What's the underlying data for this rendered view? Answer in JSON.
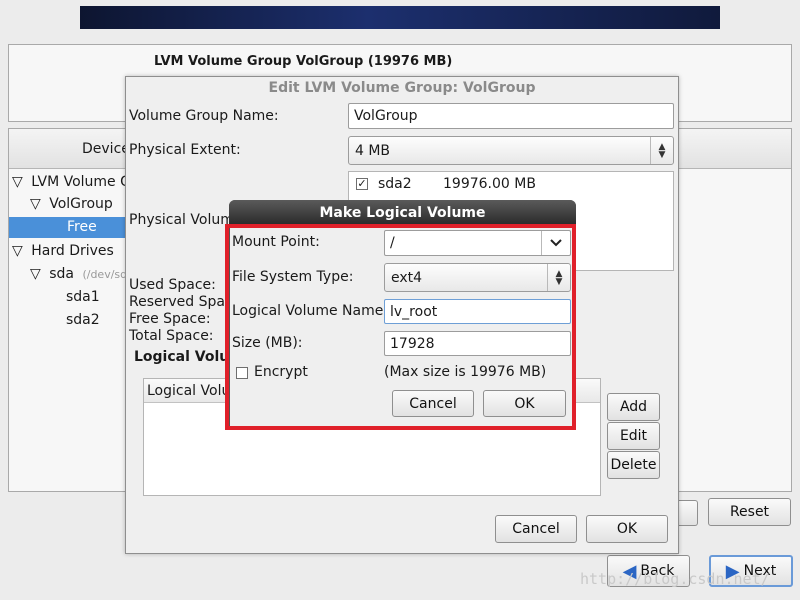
{
  "outer": {
    "group_header": "LVM Volume Group VolGroup (19976 MB)",
    "device_col_label": "Device",
    "tree": [
      {
        "label": "LVM Volume G"
      },
      {
        "label": "VolGroup"
      },
      {
        "label": "Free"
      },
      {
        "label": "Hard Drives"
      },
      {
        "label": "sda",
        "sub": "(/dev/sda"
      },
      {
        "label": "sda1"
      },
      {
        "label": "sda2"
      }
    ],
    "reset_label": "Reset",
    "back_label": "Back",
    "next_label": "Next",
    "watermark": "http://blog.csdn.net/"
  },
  "edit_dialog": {
    "title": "Edit LVM Volume Group: VolGroup",
    "vg_name_label": "Volume Group Name:",
    "vg_name_value": "VolGroup",
    "pe_label": "Physical Extent:",
    "pe_value": "4 MB",
    "pv_label": "Physical Volum",
    "pv_item_name": "sda2",
    "pv_item_size": "19976.00 MB",
    "used_space_label": "Used Space:",
    "reserved_space_label": "Reserved Spac",
    "free_space_label": "Free Space:",
    "total_space_label": "Total Space:",
    "lv_section_label": "Logical Volu",
    "lv_table_header": "Logical Volu",
    "add_label": "Add",
    "edit_label": "Edit",
    "delete_label": "Delete",
    "cancel_label": "Cancel",
    "ok_label": "OK"
  },
  "make_lv": {
    "title": "Make Logical Volume",
    "mount_label": "Mount Point:",
    "mount_value": "/",
    "fs_label": "File System Type:",
    "fs_value": "ext4",
    "lv_name_label": "Logical Volume Name:",
    "lv_name_value": "lv_root",
    "size_label": "Size (MB):",
    "size_value": "17928",
    "encrypt_label": "Encrypt",
    "max_size_text": "(Max size is 19976 MB)",
    "cancel_label": "Cancel",
    "ok_label": "OK"
  },
  "colors": {
    "highlight_border": "#e0202a",
    "selection": "#4a90d9"
  }
}
